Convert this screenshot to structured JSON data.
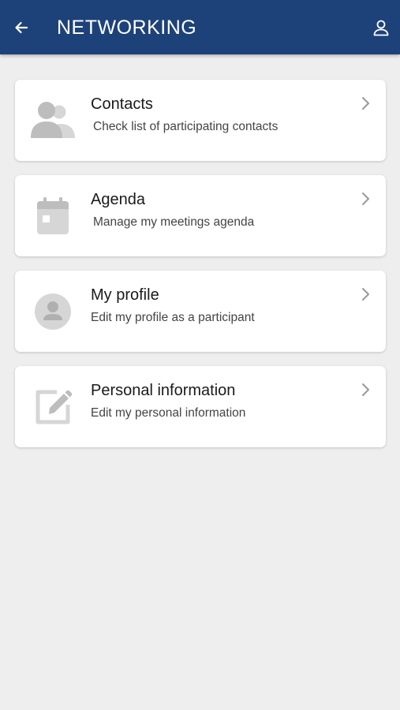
{
  "header": {
    "title": "NETWORKING",
    "background_color": "#1d4279",
    "back_icon": "arrow-left-icon",
    "account_icon": "person-outline-icon"
  },
  "menu": {
    "items": [
      {
        "title": "Contacts",
        "subtitle": "Check list of participating contacts",
        "icon": "people-icon"
      },
      {
        "title": "Agenda",
        "subtitle": "Manage my meetings agenda",
        "icon": "calendar-icon"
      },
      {
        "title": "My profile",
        "subtitle": "Edit my profile as a participant",
        "icon": "account-circle-icon"
      },
      {
        "title": "Personal information",
        "subtitle": "Edit my personal information",
        "icon": "edit-note-icon"
      }
    ],
    "chevron_icon": "chevron-right-icon",
    "icon_color": "#bdbdbd"
  }
}
